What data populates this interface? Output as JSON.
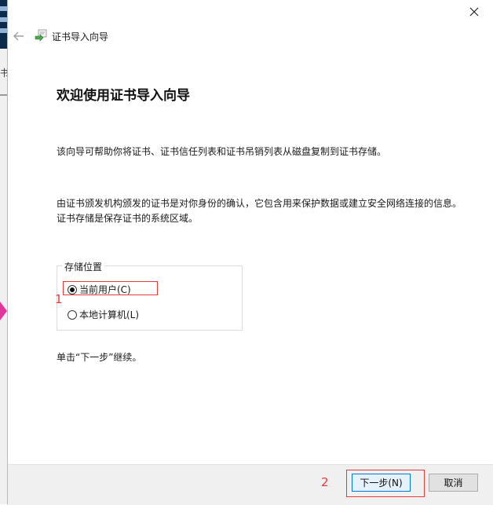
{
  "wizard": {
    "title": "证书导入向导",
    "heading": "欢迎使用证书导入向导",
    "description1": "该向导可帮助你将证书、证书信任列表和证书吊销列表从磁盘复制到证书存储。",
    "description2": "由证书颁发机构颁发的证书是对你身份的确认，它包含用来保护数据或建立安全网络连接的信息。证书存储是保存证书的系统区域。",
    "store_location": {
      "legend": "存储位置",
      "options": [
        {
          "label": "当前用户(C)",
          "checked": true
        },
        {
          "label": "本地计算机(L)",
          "checked": false
        }
      ]
    },
    "continue_text": "单击“下一步”继续。"
  },
  "buttons": {
    "next": "下一步(N)",
    "cancel": "取消"
  },
  "annotations": {
    "step1": "1",
    "step2": "2",
    "color": "#e23b3b"
  },
  "icons": {
    "close": "close-icon",
    "back": "back-arrow-icon",
    "wizard": "certificate-wizard-icon"
  },
  "background_window": {
    "chars": [
      "书"
    ]
  }
}
